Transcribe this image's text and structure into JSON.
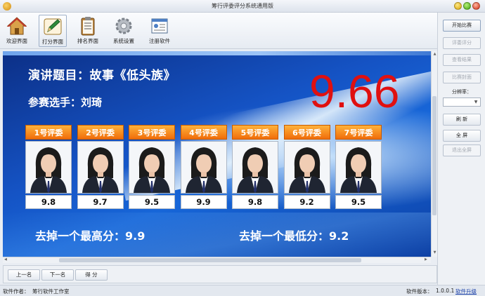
{
  "window": {
    "title": "筹行评委评分系统通用版"
  },
  "toolbar": {
    "items": [
      {
        "label": "欢迎界面",
        "icon": "house-icon"
      },
      {
        "label": "打分界面",
        "icon": "pencil-icon"
      },
      {
        "label": "排名界面",
        "icon": "clipboard-icon"
      },
      {
        "label": "系统设置",
        "icon": "gear-icon"
      },
      {
        "label": "注册软件",
        "icon": "register-icon"
      }
    ]
  },
  "side": {
    "start": "开始比赛",
    "judge_score": "评委评分",
    "view_result": "查看结果",
    "cover": "比赛封面",
    "rate_label": "分辨率：",
    "rate_value": "",
    "refresh": "刷  新",
    "fullscreen": "全  屏",
    "exit_fullscreen": "退出全屏"
  },
  "stage": {
    "topic": "演讲题目：故事《低头族》",
    "player": "参赛选手：刘琦",
    "final_score": "9.66",
    "drop_high": "去掉一个最高分：9.9",
    "drop_low": "去掉一个最低分：9.2",
    "judges": [
      {
        "label": "1号评委",
        "score": "9.8"
      },
      {
        "label": "2号评委",
        "score": "9.7"
      },
      {
        "label": "3号评委",
        "score": "9.5"
      },
      {
        "label": "4号评委",
        "score": "9.9"
      },
      {
        "label": "5号评委",
        "score": "9.8"
      },
      {
        "label": "6号评委",
        "score": "9.2"
      },
      {
        "label": "7号评委",
        "score": "9.5"
      }
    ]
  },
  "nav": {
    "prev": "上一名",
    "next": "下一名",
    "score": "得  分"
  },
  "status": {
    "author_label": "软件作者：",
    "author": "筹行软件工作室",
    "version_label": "软件版本：",
    "version": "1.0.0.1",
    "upgrade": "软件升级"
  },
  "colors": {
    "score_red": "#e01010",
    "judge_header": "#f06d0a",
    "stage_blue": "#1553c4"
  }
}
